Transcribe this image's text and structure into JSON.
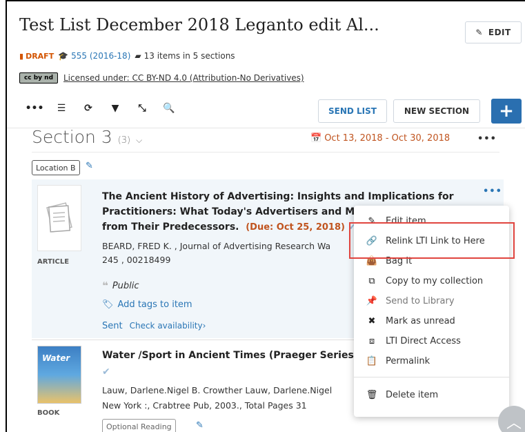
{
  "header": {
    "title": "Test List December 2018 Leganto edit Al...",
    "edit_label": "EDIT"
  },
  "meta": {
    "draft": "DRAFT",
    "course": "555 (2016-18)",
    "items": "13 items in 5 sections"
  },
  "license": {
    "badge": "cc by nd",
    "text": "Licensed under: CC BY-ND 4.0 (Attribution-No Derivatives)"
  },
  "toolbar": {
    "send_list": "SEND LIST",
    "new_section": "NEW SECTION",
    "plus": "+"
  },
  "section": {
    "title": "Section 3",
    "count": "(3)",
    "dates": "Oct 13, 2018 - Oct 30, 2018",
    "location_tag": "Location B"
  },
  "item1": {
    "type": "ARTICLE",
    "title_l1": "The Ancient History of Advertising: Insights and Implications for",
    "title_l2": "Practitioners: What Today's Advertisers and Ma",
    "title_l3": "from Their Predecessors.",
    "due": "(Due:  Oct 25, 2018)",
    "author_l1": "BEARD, FRED K. , Journal of Advertising Research Wa",
    "author_l2": "245 , 00218499",
    "public": "Public",
    "add_tags": "Add tags to item",
    "sent": "Sent",
    "check_availability": "Check availability›"
  },
  "item2": {
    "type": "BOOK",
    "thumb_text": "Water",
    "title": "Water /Sport in Ancient Times (Praeger Series c",
    "author_l1": "Lauw, Darlene.Nigel B. Crowther Lauw, Darlene.Nigel",
    "author_l2": "New York :, Crabtree Pub, 2003., Total Pages 31",
    "optional_tag": "Optional Reading"
  },
  "menu": {
    "items": [
      {
        "label": "Edit item"
      },
      {
        "label": "Relink LTI Link to Here"
      },
      {
        "label": "Bag It"
      },
      {
        "label": "Copy to my collection"
      },
      {
        "label": "Send to Library"
      },
      {
        "label": "Mark as unread"
      },
      {
        "label": "LTI Direct Access"
      },
      {
        "label": "Permalink"
      },
      {
        "label": "Delete item"
      }
    ]
  },
  "colors": {
    "accent": "#2a76b5",
    "primary_button": "#2a6fb0",
    "draft": "#d35400",
    "due": "#c0541f",
    "highlight": "#e0443e",
    "item_bg": "#f1f6fa"
  }
}
